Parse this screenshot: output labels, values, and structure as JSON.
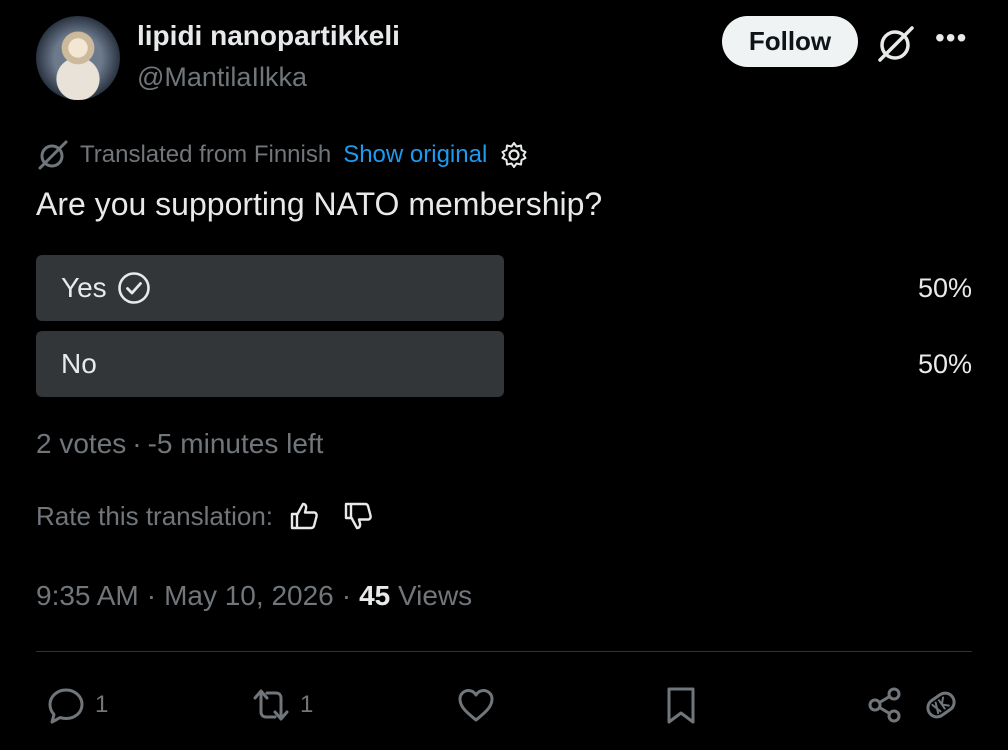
{
  "author": {
    "display_name": "lipidi nanopartikkeli",
    "handle": "@MantilaIlkka",
    "follow_label": "Follow",
    "grok_icon": "grok-icon",
    "more_label": "•••"
  },
  "translation": {
    "note": "Translated from Finnish",
    "show_original_label": "Show original",
    "rate_label": "Rate this translation:"
  },
  "post": {
    "text": "Are you supporting NATO membership?"
  },
  "poll": {
    "options": [
      {
        "label": "Yes",
        "percent_label": "50%",
        "share": 0.5,
        "selected": true
      },
      {
        "label": "No",
        "percent_label": "50%",
        "share": 0.5,
        "selected": false
      }
    ],
    "votes": "2 votes",
    "time_left": "-5 minutes left"
  },
  "meta": {
    "time": "9:35 AM",
    "date": "May 10, 2026",
    "views_count": "45",
    "views_label": "Views"
  },
  "actions": {
    "reply_count": "1",
    "repost_count": "1"
  },
  "colors": {
    "background": "#000000",
    "text_primary": "#e7e9ea",
    "text_secondary": "#71767b",
    "link": "#1d9bf0",
    "poll_fill": "#333639"
  }
}
